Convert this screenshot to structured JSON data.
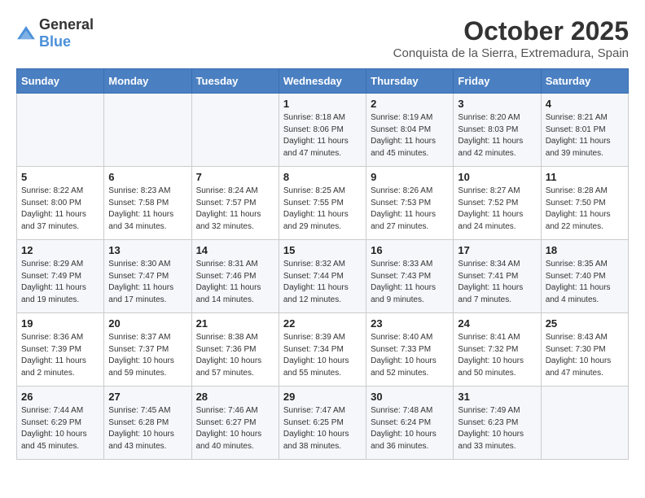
{
  "logo": {
    "general": "General",
    "blue": "Blue"
  },
  "header": {
    "month": "October 2025",
    "location": "Conquista de la Sierra, Extremadura, Spain"
  },
  "days_of_week": [
    "Sunday",
    "Monday",
    "Tuesday",
    "Wednesday",
    "Thursday",
    "Friday",
    "Saturday"
  ],
  "weeks": [
    [
      {
        "day": "",
        "info": ""
      },
      {
        "day": "",
        "info": ""
      },
      {
        "day": "",
        "info": ""
      },
      {
        "day": "1",
        "info": "Sunrise: 8:18 AM\nSunset: 8:06 PM\nDaylight: 11 hours and 47 minutes."
      },
      {
        "day": "2",
        "info": "Sunrise: 8:19 AM\nSunset: 8:04 PM\nDaylight: 11 hours and 45 minutes."
      },
      {
        "day": "3",
        "info": "Sunrise: 8:20 AM\nSunset: 8:03 PM\nDaylight: 11 hours and 42 minutes."
      },
      {
        "day": "4",
        "info": "Sunrise: 8:21 AM\nSunset: 8:01 PM\nDaylight: 11 hours and 39 minutes."
      }
    ],
    [
      {
        "day": "5",
        "info": "Sunrise: 8:22 AM\nSunset: 8:00 PM\nDaylight: 11 hours and 37 minutes."
      },
      {
        "day": "6",
        "info": "Sunrise: 8:23 AM\nSunset: 7:58 PM\nDaylight: 11 hours and 34 minutes."
      },
      {
        "day": "7",
        "info": "Sunrise: 8:24 AM\nSunset: 7:57 PM\nDaylight: 11 hours and 32 minutes."
      },
      {
        "day": "8",
        "info": "Sunrise: 8:25 AM\nSunset: 7:55 PM\nDaylight: 11 hours and 29 minutes."
      },
      {
        "day": "9",
        "info": "Sunrise: 8:26 AM\nSunset: 7:53 PM\nDaylight: 11 hours and 27 minutes."
      },
      {
        "day": "10",
        "info": "Sunrise: 8:27 AM\nSunset: 7:52 PM\nDaylight: 11 hours and 24 minutes."
      },
      {
        "day": "11",
        "info": "Sunrise: 8:28 AM\nSunset: 7:50 PM\nDaylight: 11 hours and 22 minutes."
      }
    ],
    [
      {
        "day": "12",
        "info": "Sunrise: 8:29 AM\nSunset: 7:49 PM\nDaylight: 11 hours and 19 minutes."
      },
      {
        "day": "13",
        "info": "Sunrise: 8:30 AM\nSunset: 7:47 PM\nDaylight: 11 hours and 17 minutes."
      },
      {
        "day": "14",
        "info": "Sunrise: 8:31 AM\nSunset: 7:46 PM\nDaylight: 11 hours and 14 minutes."
      },
      {
        "day": "15",
        "info": "Sunrise: 8:32 AM\nSunset: 7:44 PM\nDaylight: 11 hours and 12 minutes."
      },
      {
        "day": "16",
        "info": "Sunrise: 8:33 AM\nSunset: 7:43 PM\nDaylight: 11 hours and 9 minutes."
      },
      {
        "day": "17",
        "info": "Sunrise: 8:34 AM\nSunset: 7:41 PM\nDaylight: 11 hours and 7 minutes."
      },
      {
        "day": "18",
        "info": "Sunrise: 8:35 AM\nSunset: 7:40 PM\nDaylight: 11 hours and 4 minutes."
      }
    ],
    [
      {
        "day": "19",
        "info": "Sunrise: 8:36 AM\nSunset: 7:39 PM\nDaylight: 11 hours and 2 minutes."
      },
      {
        "day": "20",
        "info": "Sunrise: 8:37 AM\nSunset: 7:37 PM\nDaylight: 10 hours and 59 minutes."
      },
      {
        "day": "21",
        "info": "Sunrise: 8:38 AM\nSunset: 7:36 PM\nDaylight: 10 hours and 57 minutes."
      },
      {
        "day": "22",
        "info": "Sunrise: 8:39 AM\nSunset: 7:34 PM\nDaylight: 10 hours and 55 minutes."
      },
      {
        "day": "23",
        "info": "Sunrise: 8:40 AM\nSunset: 7:33 PM\nDaylight: 10 hours and 52 minutes."
      },
      {
        "day": "24",
        "info": "Sunrise: 8:41 AM\nSunset: 7:32 PM\nDaylight: 10 hours and 50 minutes."
      },
      {
        "day": "25",
        "info": "Sunrise: 8:43 AM\nSunset: 7:30 PM\nDaylight: 10 hours and 47 minutes."
      }
    ],
    [
      {
        "day": "26",
        "info": "Sunrise: 7:44 AM\nSunset: 6:29 PM\nDaylight: 10 hours and 45 minutes."
      },
      {
        "day": "27",
        "info": "Sunrise: 7:45 AM\nSunset: 6:28 PM\nDaylight: 10 hours and 43 minutes."
      },
      {
        "day": "28",
        "info": "Sunrise: 7:46 AM\nSunset: 6:27 PM\nDaylight: 10 hours and 40 minutes."
      },
      {
        "day": "29",
        "info": "Sunrise: 7:47 AM\nSunset: 6:25 PM\nDaylight: 10 hours and 38 minutes."
      },
      {
        "day": "30",
        "info": "Sunrise: 7:48 AM\nSunset: 6:24 PM\nDaylight: 10 hours and 36 minutes."
      },
      {
        "day": "31",
        "info": "Sunrise: 7:49 AM\nSunset: 6:23 PM\nDaylight: 10 hours and 33 minutes."
      },
      {
        "day": "",
        "info": ""
      }
    ]
  ]
}
